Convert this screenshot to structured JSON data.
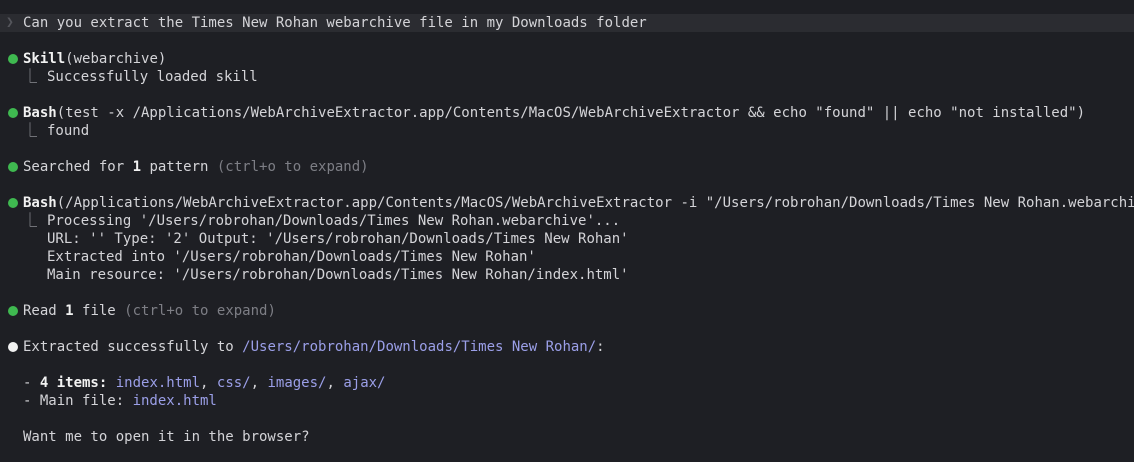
{
  "prompt": {
    "chevron": "❯",
    "text": "Can you extract the Times New Rohan webarchive file in my Downloads folder"
  },
  "entries": {
    "skill": {
      "tool": "Skill",
      "args": "(webarchive)",
      "result": "Successfully loaded skill"
    },
    "bash1": {
      "tool": "Bash",
      "args": "(test -x /Applications/WebArchiveExtractor.app/Contents/MacOS/WebArchiveExtractor && echo \"found\" || echo \"not installed\")",
      "result": "found"
    },
    "search": {
      "prefix": "Searched for ",
      "count": "1",
      "suffix": " pattern ",
      "hint": "(ctrl+o to expand)"
    },
    "bash2": {
      "tool": "Bash",
      "args": "(/Applications/WebArchiveExtractor.app/Contents/MacOS/WebArchiveExtractor -i \"/Users/robrohan/Downloads/Times New Rohan.webarchive\")",
      "output": [
        "Processing '/Users/robrohan/Downloads/Times New Rohan.webarchive'...",
        "URL: '' Type: '2' Output: '/Users/robrohan/Downloads/Times New Rohan'",
        "Extracted into '/Users/robrohan/Downloads/Times New Rohan'",
        "Main resource: '/Users/robrohan/Downloads/Times New Rohan/index.html'"
      ]
    },
    "read": {
      "prefix": "Read ",
      "count": "1",
      "suffix": " file ",
      "hint": "(ctrl+o to expand)"
    }
  },
  "response": {
    "lead": "Extracted successfully to ",
    "path": "/Users/robrohan/Downloads/Times New Rohan/",
    "colon": ":",
    "items_dash": "- ",
    "items_label": "4 items:",
    "items": [
      "index.html",
      "css/",
      "images/",
      "ajax/"
    ],
    "main_dash": "- Main file: ",
    "main_file": "index.html",
    "question": "Want me to open it in the browser?"
  },
  "colors": {
    "background": "#1e1f24",
    "success_dot": "#3fb950",
    "path": "#9b9fe8",
    "dim": "#7d7e85"
  }
}
